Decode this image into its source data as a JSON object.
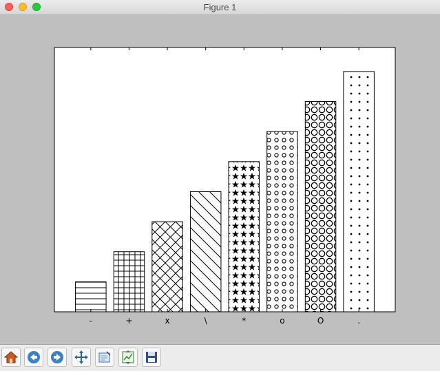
{
  "window": {
    "title": "Figure 1"
  },
  "chart_data": {
    "type": "bar",
    "categories": [
      "-",
      "+",
      "x",
      "\\",
      "*",
      "o",
      "O",
      "."
    ],
    "hatches": [
      "-",
      "+",
      "x",
      "\\",
      "*",
      "o",
      "O",
      "."
    ],
    "values": [
      1,
      2,
      3,
      4,
      5,
      6,
      7,
      8
    ],
    "title": "",
    "xlabel": "",
    "ylabel": "",
    "ylim": [
      0,
      8.8
    ],
    "yticks": "hidden",
    "grid": false,
    "bar_fill": "#ffffff",
    "bar_edge": "#000000"
  },
  "toolbar": {
    "buttons": [
      {
        "name": "home-button",
        "icon": "home-icon"
      },
      {
        "name": "back-button",
        "icon": "back-arrow-icon"
      },
      {
        "name": "forward-button",
        "icon": "forward-arrow-icon"
      },
      {
        "name": "pan-button",
        "icon": "pan-move-icon"
      },
      {
        "name": "zoom-button",
        "icon": "zoom-rect-icon"
      },
      {
        "name": "subplots-button",
        "icon": "subplots-config-icon"
      },
      {
        "name": "save-button",
        "icon": "save-floppy-icon"
      }
    ]
  }
}
